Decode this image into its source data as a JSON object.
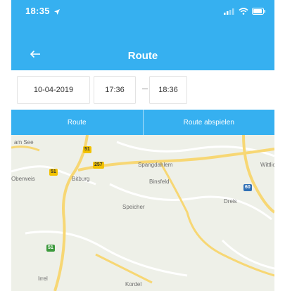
{
  "colors": {
    "accent": "#36b0f0",
    "map_bg": "#eef0e8",
    "road_major": "#f7d774",
    "road_minor": "#ffffff"
  },
  "status_bar": {
    "time": "18:35",
    "icons": [
      "location-arrow-icon",
      "signal-icon",
      "wifi-icon",
      "battery-icon"
    ]
  },
  "nav": {
    "back_icon": "back-arrow-icon",
    "title": "Route"
  },
  "filters": {
    "date": "10-04-2019",
    "start_time": "17:36",
    "end_time": "18:36"
  },
  "tabs": [
    {
      "label": "Route"
    },
    {
      "label": "Route abspielen"
    }
  ],
  "map": {
    "places": [
      "am See",
      "Oberweis",
      "Bitburg",
      "Spangdahlem",
      "Binsfeld",
      "Wittlich",
      "Speicher",
      "Dreis",
      "Irrel",
      "Kordel"
    ],
    "road_shields": [
      "51",
      "257",
      "51",
      "60",
      "51"
    ]
  }
}
